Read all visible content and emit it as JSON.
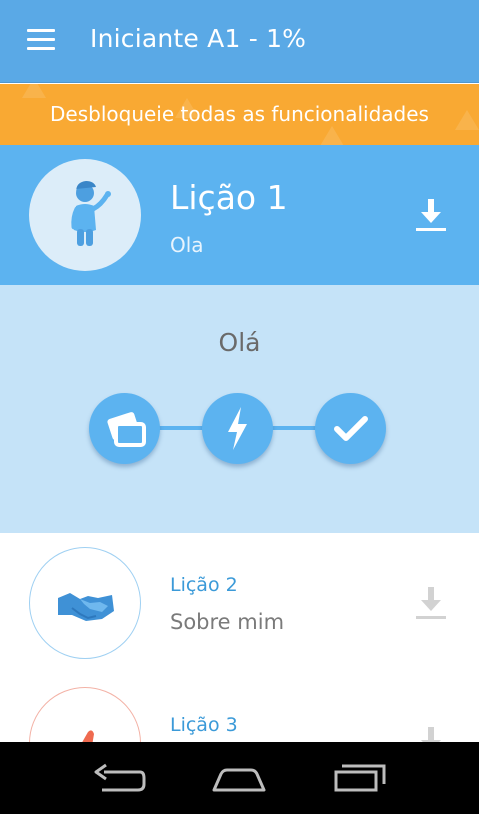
{
  "appbar": {
    "title": "Iniciante A1 - 1%",
    "menu_icon": "hamburger-menu-icon"
  },
  "promo": {
    "text": "Desbloqueie todas as funcionalidades"
  },
  "active_lesson": {
    "title": "Lição 1",
    "subtitle": "Ola",
    "avatar_icon": "waving-person-icon",
    "download_icon": "download-icon",
    "detail_title": "Olá",
    "steps": [
      {
        "icon": "flashcards-icon"
      },
      {
        "icon": "lightning-icon"
      },
      {
        "icon": "checkmark-icon"
      }
    ]
  },
  "lessons": [
    {
      "title": "Lição 2",
      "subtitle": "Sobre mim",
      "icon": "handshake-icon"
    },
    {
      "title": "Lição 3",
      "subtitle": "",
      "icon": "thumbs-up-icon"
    }
  ],
  "navigation": {
    "back_icon": "back-icon",
    "home_icon": "home-icon",
    "recents_icon": "recent-apps-icon"
  },
  "colors": {
    "appbar": "#5aa9e6",
    "promo": "#f9a933",
    "lesson_active": "#5cb3f0",
    "lesson_detail": "#c5e3f8",
    "lesson_text": "#3b9ad8"
  }
}
